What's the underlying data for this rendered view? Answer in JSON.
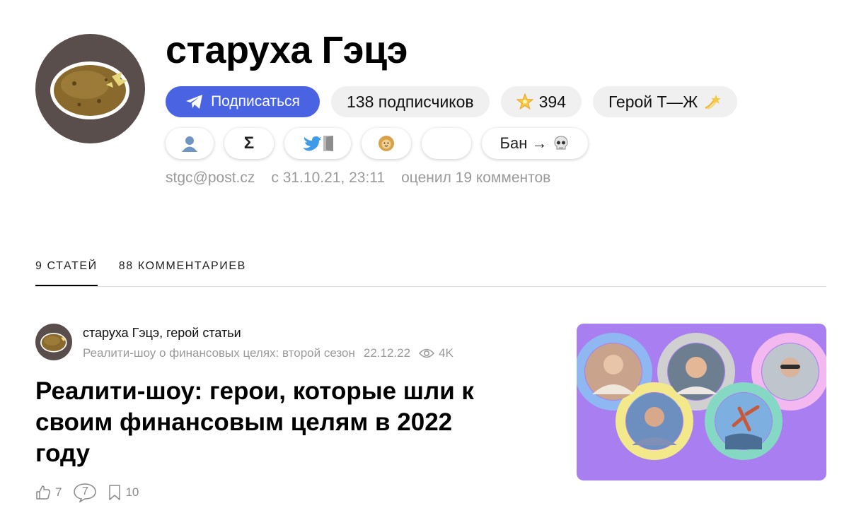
{
  "profile": {
    "name": "старуха Гэцэ",
    "subscribe_label": "Подписаться",
    "followers_label": "138 подписчиков",
    "rating_value": "394",
    "badge_label": "Герой Т—Ж",
    "ban_label": "Бан →",
    "email": "stgc@post.cz",
    "since": "с 31.10.21, 23:11",
    "rated": "оценил 19 комментов"
  },
  "tabs": [
    {
      "label": "9 СТАТЕЙ",
      "active": true
    },
    {
      "label": "88 КОММЕНТАРИЕВ",
      "active": false
    }
  ],
  "post": {
    "author_line": "старуха Гэцэ, герой статьи",
    "series": "Реалити-шоу о финансовых целях: второй сезон",
    "date": "22.12.22",
    "views": "4K",
    "title": "Реалити-шоу: герои, которые шли к своим финансовым целям в 2022 году",
    "likes": "7",
    "comments": "7",
    "bookmarks": "10"
  },
  "colors": {
    "subscribe_bg": "#4a63e3",
    "chip_bg": "#f0f0f0",
    "avatar_bg": "#5a4e4c",
    "thumbnail_bg": "#a87ef0",
    "meta_text": "#9a9a9a"
  },
  "icons": {
    "subscribe": "telegram-plane-icon",
    "rating": "star-icon",
    "badge": "shooting-star-icon",
    "row2": [
      "person-icon",
      "sigma-icon",
      "twitter-bird-door-icon",
      "lion-icon",
      "empty-badge",
      "skull-icon"
    ],
    "meta": [
      "eye-icon",
      "thumbs-up-icon",
      "comment-bubble-icon",
      "bookmark-icon"
    ]
  }
}
